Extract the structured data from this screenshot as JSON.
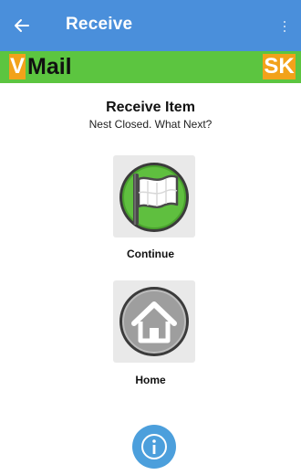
{
  "appbar": {
    "title": "Receive",
    "back_icon": "arrow-left-icon",
    "overflow_icon": "more-vert-icon",
    "color": "#4a8fdb"
  },
  "brand": {
    "v_letter": "V",
    "name": "Mail",
    "badge": "SK",
    "bar_color": "#5cc540",
    "accent_color": "#f2a21a"
  },
  "main": {
    "heading": "Receive Item",
    "subheading": "Nest Closed. What Next?"
  },
  "actions": [
    {
      "label": "Continue",
      "icon": "flag-icon"
    },
    {
      "label": "Home",
      "icon": "home-icon"
    }
  ],
  "info_button": {
    "icon": "info-icon",
    "color": "#4c9fdc"
  }
}
